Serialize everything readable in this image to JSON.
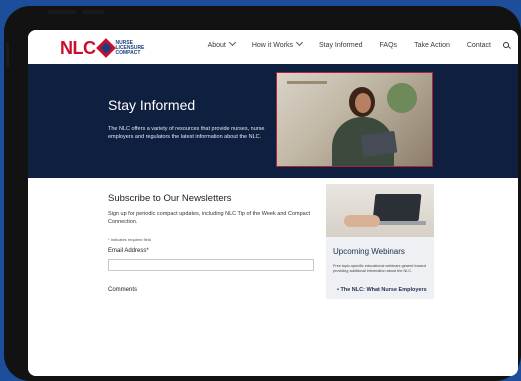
{
  "nav": {
    "logo_main": "NLC",
    "logo_line1": "NURSE",
    "logo_line2": "LICENSURE",
    "logo_line3": "COMPACT",
    "items": [
      {
        "label": "About",
        "dropdown": true
      },
      {
        "label": "How it Works",
        "dropdown": true
      },
      {
        "label": "Stay Informed",
        "dropdown": false
      },
      {
        "label": "FAQs",
        "dropdown": false
      },
      {
        "label": "Take Action",
        "dropdown": false
      },
      {
        "label": "Contact",
        "dropdown": false
      }
    ],
    "search_icon": "search-icon"
  },
  "hero": {
    "title": "Stay Informed",
    "description": "The NLC offers a variety of resources that provide nurses, nurse employers and regulators the latest information about the NLC."
  },
  "newsletter": {
    "title": "Subscribe to Our Newsletters",
    "description": "Sign up for periodic compact updates, including NLC Tip of the Week and Compact Connection.",
    "required_note": "* Indicates required field",
    "email_label": "Email Address*",
    "email_value": "",
    "comments_label": "Comments"
  },
  "webinars": {
    "title": "Upcoming Webinars",
    "description": "Free topic-specific educational webinars geared toward providing additional information about the NLC.",
    "items": [
      "The NLC: What Nurse Employers"
    ]
  },
  "colors": {
    "background": "#1d4e9b",
    "hero_bg": "#0e1f3f",
    "brand_red": "#c8102e",
    "brand_navy": "#1c3f7a"
  }
}
